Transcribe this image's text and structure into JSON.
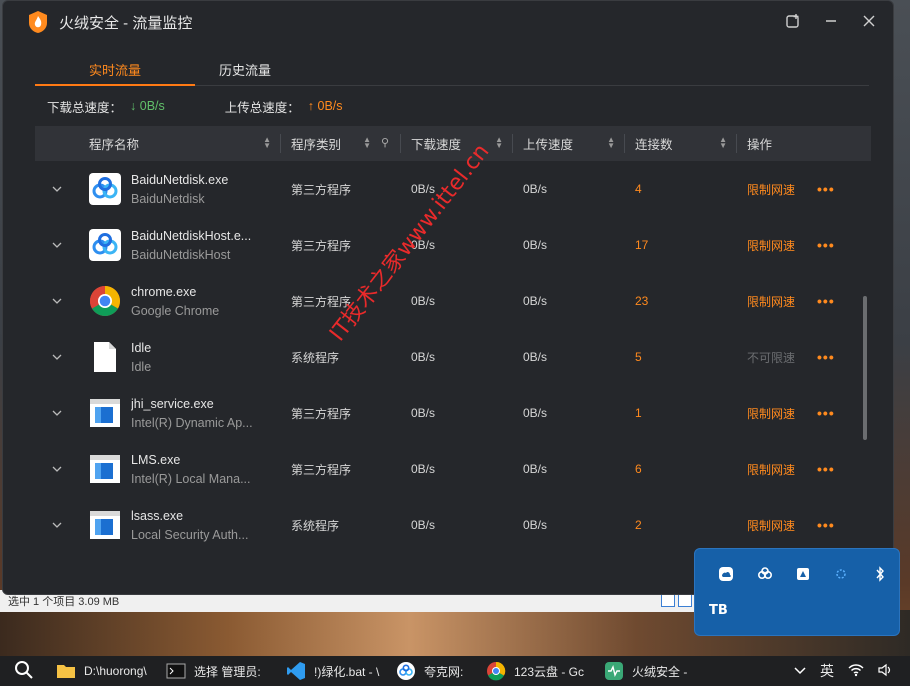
{
  "app": {
    "title": "火绒安全 - 流量监控",
    "tabs": [
      {
        "label": "实时流量",
        "active": true
      },
      {
        "label": "历史流量",
        "active": false
      }
    ],
    "download_total_label": "下载总速度：",
    "download_total_value": "↓ 0B/s",
    "upload_total_label": "上传总速度：",
    "upload_total_value": "↑ 0B/s"
  },
  "table": {
    "columns": [
      "程序名称",
      "程序类别",
      "下载速度",
      "上传速度",
      "连接数",
      "操作"
    ],
    "rows": [
      {
        "name": "BaiduNetdisk.exe",
        "desc": "BaiduNetdisk",
        "icon": "baidu-netdisk-icon",
        "category": "第三方程序",
        "down": "0B/s",
        "up": "0B/s",
        "conn": "4",
        "action": "限制网速",
        "action_enabled": true
      },
      {
        "name": "BaiduNetdiskHost.e...",
        "desc": "BaiduNetdiskHost",
        "icon": "baidu-netdisk-icon",
        "category": "第三方程序",
        "down": "0B/s",
        "up": "0B/s",
        "conn": "17",
        "action": "限制网速",
        "action_enabled": true
      },
      {
        "name": "chrome.exe",
        "desc": "Google Chrome",
        "icon": "chrome-icon",
        "category": "第三方程序",
        "down": "0B/s",
        "up": "0B/s",
        "conn": "23",
        "action": "限制网速",
        "action_enabled": true
      },
      {
        "name": "Idle",
        "desc": "Idle",
        "icon": "file-icon",
        "category": "系统程序",
        "down": "0B/s",
        "up": "0B/s",
        "conn": "5",
        "action": "不可限速",
        "action_enabled": false
      },
      {
        "name": "jhi_service.exe",
        "desc": "Intel(R) Dynamic Ap...",
        "icon": "window-app-icon",
        "category": "第三方程序",
        "down": "0B/s",
        "up": "0B/s",
        "conn": "1",
        "action": "限制网速",
        "action_enabled": true
      },
      {
        "name": "LMS.exe",
        "desc": "Intel(R) Local Mana...",
        "icon": "window-app-icon",
        "category": "第三方程序",
        "down": "0B/s",
        "up": "0B/s",
        "conn": "6",
        "action": "限制网速",
        "action_enabled": true
      },
      {
        "name": "lsass.exe",
        "desc": "Local Security Auth...",
        "icon": "window-app-icon",
        "category": "系统程序",
        "down": "0B/s",
        "up": "0B/s",
        "conn": "2",
        "action": "限制网速",
        "action_enabled": true
      }
    ]
  },
  "watermark": "IT技术之家www.ittel.cn",
  "explorer_status": "选中 1 个项目  3.09 MB",
  "tray_popup_text": "TB",
  "taskbar": {
    "items": [
      {
        "label": "D:\\huorong\\",
        "icon": "folder-icon"
      },
      {
        "label": "选择 管理员:",
        "icon": "terminal-icon"
      },
      {
        "label": "!)绿化.bat - \\",
        "icon": "vscode-icon"
      },
      {
        "label": "夸克网:",
        "icon": "baidu-netdisk-icon"
      },
      {
        "label": "123云盘 - Gc",
        "icon": "chrome-icon"
      },
      {
        "label": "火绒安全 -",
        "icon": "huorong-icon"
      }
    ],
    "ime": "英"
  },
  "colors": {
    "accent": "#ff8a1e",
    "download": "#61c06a",
    "bg": "#25272b"
  }
}
